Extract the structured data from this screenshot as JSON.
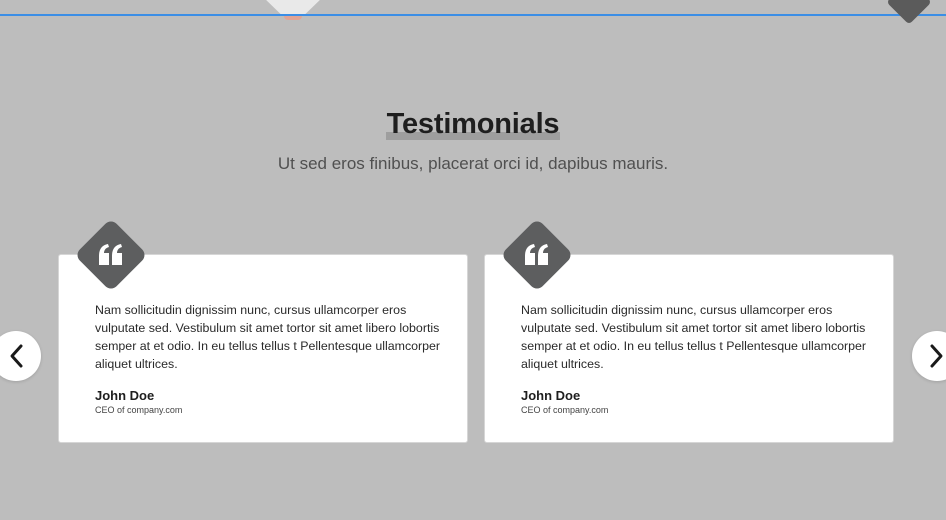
{
  "section": {
    "title": "Testimonials",
    "subtitle": "Ut sed eros finibus, placerat orci id, dapibus mauris."
  },
  "testimonials": [
    {
      "quote": "Nam sollicitudin dignissim nunc, cursus ullamcorper eros vulputate sed. Vestibulum sit amet tortor sit amet libero lobortis semper at et odio. In eu tellus tellus t Pellentesque ullamcorper aliquet ultrices.",
      "author": "John Doe",
      "role": "CEO of company.com"
    },
    {
      "quote": "Nam sollicitudin dignissim nunc, cursus ullamcorper eros vulputate sed. Vestibulum sit amet tortor sit amet libero lobortis semper at et odio. In eu tellus tellus t Pellentesque ullamcorper aliquet ultrices.",
      "author": "John Doe",
      "role": "CEO of company.com"
    }
  ],
  "icons": {
    "quote": "quote-icon",
    "prev": "chevron-left-icon",
    "next": "chevron-right-icon"
  },
  "colors": {
    "background": "#bdbdbd",
    "accent_line": "#3b8ee6",
    "badge": "#5d5e5f",
    "card": "#ffffff"
  }
}
